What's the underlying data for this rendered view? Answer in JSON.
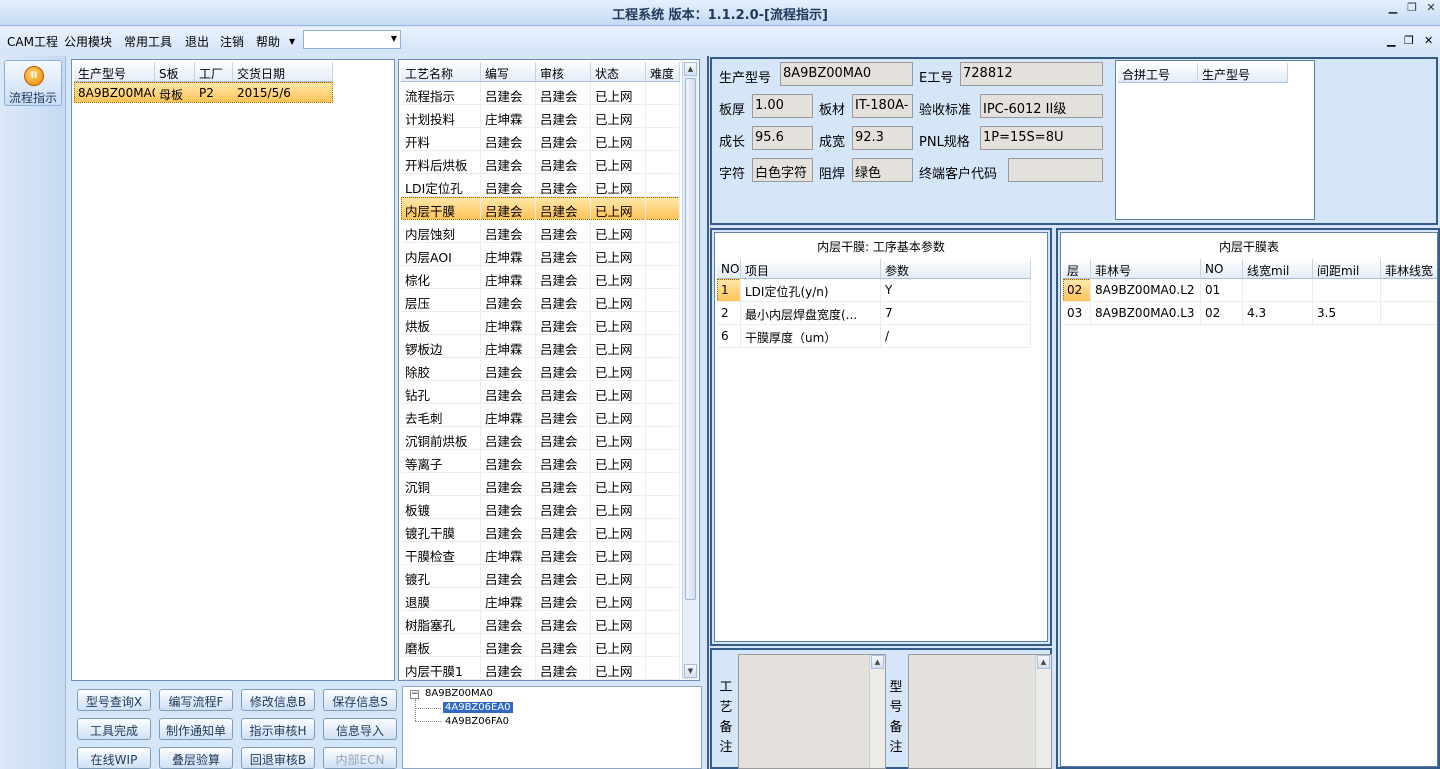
{
  "window": {
    "title": "工程系统 版本：1.1.2.0-[流程指示]"
  },
  "menu": {
    "items": [
      "CAM工程",
      "公用模块",
      "常用工具",
      "退出",
      "注销",
      "帮助"
    ],
    "combo_value": ""
  },
  "nav": {
    "button_label": "流程指示"
  },
  "orders": {
    "columns": [
      "生产型号",
      "S板",
      "工厂",
      "交货日期"
    ],
    "rows": [
      [
        "8A9BZ00MA0",
        "母板",
        "P2",
        "2015/5/6"
      ]
    ]
  },
  "process": {
    "columns": [
      "工艺名称",
      "编写",
      "审核",
      "状态",
      "难度"
    ],
    "rows": [
      [
        "流程指示",
        "吕建会",
        "吕建会",
        "已上网"
      ],
      [
        "计划投料",
        "庄坤霖",
        "吕建会",
        "已上网"
      ],
      [
        "开料",
        "吕建会",
        "吕建会",
        "已上网"
      ],
      [
        "开料后烘板",
        "吕建会",
        "吕建会",
        "已上网"
      ],
      [
        "LDI定位孔",
        "吕建会",
        "吕建会",
        "已上网"
      ],
      [
        "内层干膜",
        "吕建会",
        "吕建会",
        "已上网"
      ],
      [
        "内层蚀刻",
        "吕建会",
        "吕建会",
        "已上网"
      ],
      [
        "内层AOI",
        "庄坤霖",
        "吕建会",
        "已上网"
      ],
      [
        "棕化",
        "庄坤霖",
        "吕建会",
        "已上网"
      ],
      [
        "层压",
        "吕建会",
        "吕建会",
        "已上网"
      ],
      [
        "烘板",
        "庄坤霖",
        "吕建会",
        "已上网"
      ],
      [
        "锣板边",
        "庄坤霖",
        "吕建会",
        "已上网"
      ],
      [
        "除胶",
        "吕建会",
        "吕建会",
        "已上网"
      ],
      [
        "钻孔",
        "吕建会",
        "吕建会",
        "已上网"
      ],
      [
        "去毛刺",
        "庄坤霖",
        "吕建会",
        "已上网"
      ],
      [
        "沉铜前烘板",
        "吕建会",
        "吕建会",
        "已上网"
      ],
      [
        "等离子",
        "吕建会",
        "吕建会",
        "已上网"
      ],
      [
        "沉铜",
        "吕建会",
        "吕建会",
        "已上网"
      ],
      [
        "板镀",
        "吕建会",
        "吕建会",
        "已上网"
      ],
      [
        "镀孔干膜",
        "吕建会",
        "吕建会",
        "已上网"
      ],
      [
        "干膜检查",
        "庄坤霖",
        "吕建会",
        "已上网"
      ],
      [
        "镀孔",
        "吕建会",
        "吕建会",
        "已上网"
      ],
      [
        "退膜",
        "庄坤霖",
        "吕建会",
        "已上网"
      ],
      [
        "树脂塞孔",
        "吕建会",
        "吕建会",
        "已上网"
      ],
      [
        "磨板",
        "吕建会",
        "吕建会",
        "已上网"
      ],
      [
        "内层干膜1",
        "吕建会",
        "吕建会",
        "已上网"
      ]
    ],
    "selected_index": 5
  },
  "buttons": [
    [
      "型号查询X",
      "编写流程F",
      "修改信息B",
      "保存信息S"
    ],
    [
      "工具完成",
      "制作通知单",
      "指示审核H",
      "信息导入"
    ],
    [
      "在线WIP",
      "叠层验算",
      "回退审核B",
      "内部ECN"
    ]
  ],
  "tree": {
    "root": "8A9BZ00MA0",
    "children": [
      "4A9BZ06EA0",
      "4A9BZ06FA0"
    ]
  },
  "info": {
    "labels": {
      "model": "生产型号",
      "ework": "E工号",
      "thick": "板厚",
      "material": "板材",
      "std": "验收标准",
      "len": "成长",
      "wid": "成宽",
      "pnl": "PNL规格",
      "char": "字符",
      "mask": "阻焊",
      "cust": "终端客户代码"
    },
    "values": {
      "model": "8A9BZ00MA0",
      "ework": "728812",
      "thick": "1.00",
      "material": "IT-180A-",
      "std": "IPC-6012 II级",
      "len": "95.6",
      "wid": "92.3",
      "pnl": "1P=15S=8U",
      "char": "白色字符",
      "mask": "绿色",
      "cust": ""
    }
  },
  "merge": {
    "columns": [
      "合拼工号",
      "生产型号"
    ]
  },
  "params": {
    "title": "内层干膜: 工序基本参数",
    "columns": [
      "NO",
      "项目",
      "参数"
    ],
    "rows": [
      [
        "1",
        "LDI定位孔(y/n)",
        "Y"
      ],
      [
        "2",
        "最小内层焊盘宽度(...",
        "7"
      ],
      [
        "6",
        "干膜厚度（um）",
        "/"
      ]
    ]
  },
  "film": {
    "title": "内层干膜表",
    "columns": [
      "层",
      "菲林号",
      "NO",
      "线宽mil",
      "间距mil",
      "菲林线宽"
    ],
    "rows": [
      [
        "02",
        "8A9BZ00MA0.L2",
        "01",
        "",
        ""
      ],
      [
        "03",
        "8A9BZ00MA0.L3",
        "02",
        "4.3",
        "3.5"
      ]
    ]
  },
  "notes": {
    "craft_label": "工艺备注",
    "model_label": "型号备注"
  }
}
